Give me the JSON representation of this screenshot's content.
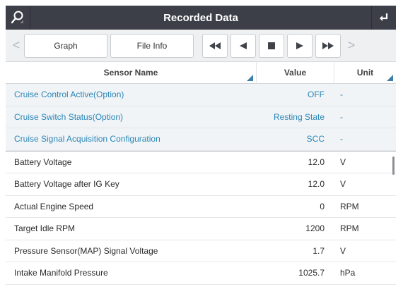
{
  "titlebar": {
    "title": "Recorded Data",
    "left_icon": "search-icon",
    "right_icon": "back-icon"
  },
  "toolbar": {
    "prev_page_icon": "chevron-left-icon",
    "graph_label": "Graph",
    "file_info_label": "File Info",
    "rewind_icon": "rewind-icon",
    "step_back_icon": "step-back-icon",
    "stop_icon": "stop-icon",
    "play_icon": "play-icon",
    "fast_forward_icon": "fast-forward-icon",
    "next_page_icon": "chevron-right-icon",
    "prev_glyph": "<",
    "next_glyph": ">"
  },
  "table": {
    "headers": {
      "name": "Sensor Name",
      "value": "Value",
      "unit": "Unit"
    },
    "highlighted_rows": [
      {
        "name": "Cruise Control Active(Option)",
        "value": "OFF",
        "unit": "-"
      },
      {
        "name": "Cruise Switch Status(Option)",
        "value": "Resting State",
        "unit": "-"
      },
      {
        "name": "Cruise Signal Acquisition Configuration",
        "value": "SCC",
        "unit": "-"
      }
    ],
    "rows": [
      {
        "name": "Battery Voltage",
        "value": "12.0",
        "unit": "V"
      },
      {
        "name": "Battery Voltage after IG Key",
        "value": "12.0",
        "unit": "V"
      },
      {
        "name": "Actual Engine Speed",
        "value": "0",
        "unit": "RPM"
      },
      {
        "name": "Target Idle RPM",
        "value": "1200",
        "unit": "RPM"
      },
      {
        "name": "Pressure Sensor(MAP) Signal Voltage",
        "value": "1.7",
        "unit": "V"
      },
      {
        "name": "Intake Manifold Pressure",
        "value": "1025.7",
        "unit": "hPa"
      }
    ]
  },
  "colors": {
    "titlebar": "#3c3f48",
    "highlight_text": "#2c86b5",
    "sort_indicator": "#3d7fa6"
  }
}
